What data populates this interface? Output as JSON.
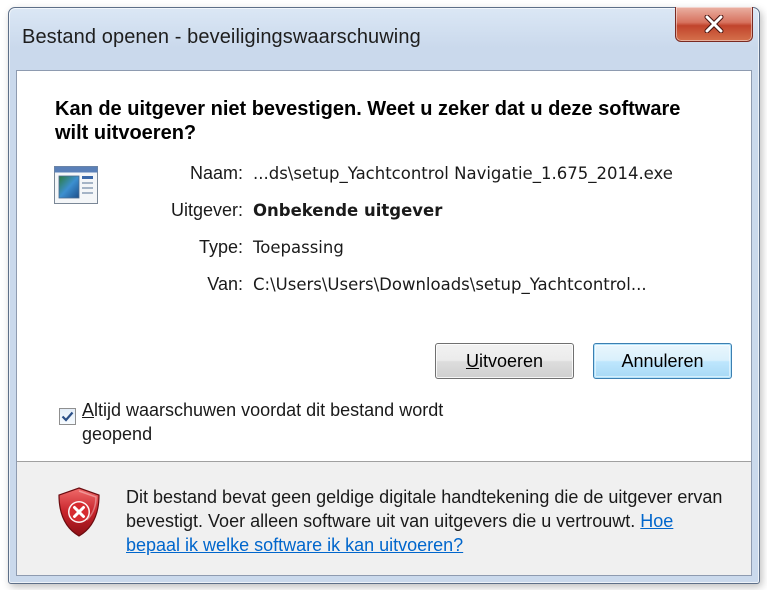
{
  "window": {
    "title": "Bestand openen - beveiligingswaarschuwing",
    "close_icon": "close-x-icon"
  },
  "heading": "Kan de uitgever niet bevestigen. Weet u zeker dat u deze software wilt uitvoeren?",
  "details": {
    "icon": "application-icon",
    "rows": [
      {
        "label": "Naam:",
        "value": "...ds\\setup_Yachtcontrol Navigatie_1.675_2014.exe",
        "bold": false
      },
      {
        "label": "Uitgever:",
        "value": "Onbekende uitgever",
        "bold": true
      },
      {
        "label": "Type:",
        "value": "Toepassing",
        "bold": false
      },
      {
        "label": "Van:",
        "value": "C:\\Users\\Users\\Downloads\\setup_Yachtcontrol...",
        "bold": false
      }
    ]
  },
  "buttons": {
    "run": {
      "label_accel": "U",
      "label_rest": "itvoeren"
    },
    "cancel": {
      "label": "Annuleren"
    }
  },
  "checkbox": {
    "checked": true,
    "label_accel": "A",
    "label_rest": "ltijd waarschuwen voordat dit bestand wordt geopend"
  },
  "footer": {
    "icon": "security-shield-error-icon",
    "text": "Dit bestand bevat geen geldige digitale handtekening die de uitgever ervan bevestigt. Voer alleen software uit van uitgevers die u vertrouwt.",
    "link": "Hoe bepaal ik welke software ik kan uitvoeren?"
  },
  "colors": {
    "link": "#0066cc",
    "close_button": "#c9523b",
    "shield_red": "#c8242b"
  }
}
